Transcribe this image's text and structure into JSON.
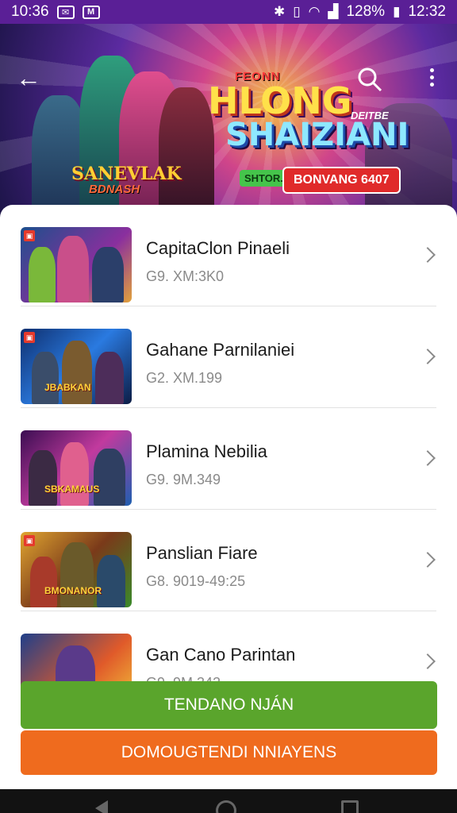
{
  "status": {
    "time": "10:36",
    "battery": "128%",
    "clock": "12:32"
  },
  "banner": {
    "logo_small": "FEONN",
    "logo_line1": "HLONG",
    "logo_line2": "SHAIZIANI",
    "logo_tag": "DEITBE",
    "badge_green": "SHTOR.",
    "badge_red": "BONVANG 6407",
    "sub_logo": "SANEVLAK",
    "sub_logo_2": "BDNASH"
  },
  "list": [
    {
      "title": "CapitaClon Pinaeli",
      "subtitle": "G9. XM:3K0",
      "caption": ""
    },
    {
      "title": "Gahane Parnilaniei",
      "subtitle": "G2. XM.199",
      "caption": "JBABKAN"
    },
    {
      "title": "Plamina Nebilia",
      "subtitle": "G9. 9M.349",
      "caption": "SBKAMAUS"
    },
    {
      "title": "Panslian Fiare",
      "subtitle": "G8. 9019-49:25",
      "caption": "BMONANOR"
    },
    {
      "title": "Gan Cano Parintan",
      "subtitle": "G9. 9M.342",
      "caption": ""
    }
  ],
  "buttons": {
    "primary": "TENDANO NJÁN",
    "secondary": "DOMOUGTENDI NNIAYENS"
  }
}
